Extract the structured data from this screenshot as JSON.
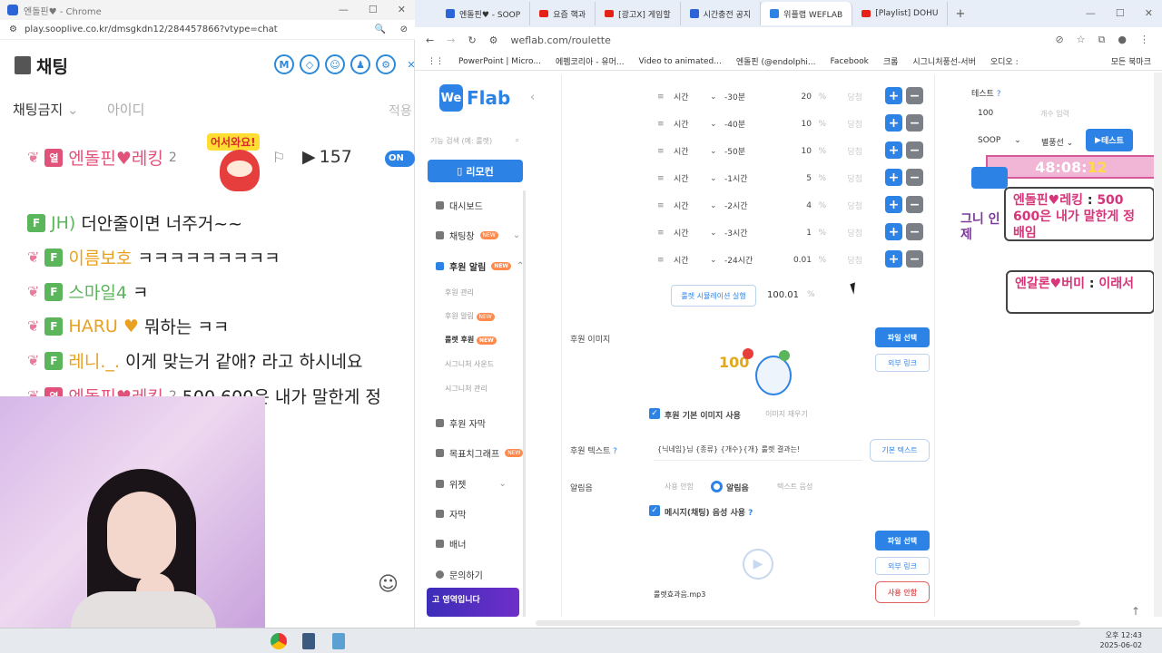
{
  "left_window": {
    "title": "엔돌핀♥ - Chrome",
    "url": "play.sooplive.co.kr/dmsgkdn12/284457866?vtype=chat",
    "chat_title": "채팅",
    "filter_label": "채팅금지",
    "filter_label2": "아이디",
    "filter_label3": "적용",
    "on_label": "ON",
    "viewer_count": "157",
    "sticker_text": "어서와요!",
    "messages": [
      {
        "badge": "열",
        "nick": "엔돌핀♥레킹",
        "level": "2",
        "text": ""
      },
      {
        "badge": "F",
        "nick": "JH)",
        "text": "더안줄이면 너주거~~"
      },
      {
        "badge": "F",
        "nick": "이름보호",
        "text": "ㅋㅋㅋㅋㅋㅋㅋㅋㅋ"
      },
      {
        "badge": "F",
        "nick": "스마일4",
        "text": "ㅋ"
      },
      {
        "badge": "F",
        "nick": "HARU",
        "text": "뭐하는 ㅋㅋ"
      },
      {
        "badge": "F",
        "nick": "레니._.",
        "text": "이게 맞는거 같애? 라고 하시네요"
      },
      {
        "badge": "열",
        "nick": "엔돌핀♥레킹",
        "level": "2",
        "text": "500 600은 내가 말한게 정"
      }
    ]
  },
  "browser": {
    "tabs": [
      {
        "label": "엔돌핀♥ - SOOP",
        "active": false
      },
      {
        "label": "요즘 핵과",
        "active": false
      },
      {
        "label": "[광고X] 게임할",
        "active": false
      },
      {
        "label": "시간충전 공지",
        "active": false
      },
      {
        "label": "위플랩 WEFLAB",
        "active": true
      },
      {
        "label": "[Playlist] DOHU",
        "active": false
      }
    ],
    "url": "weflab.com/roulette",
    "bookmarks": [
      "PowerPoint | Micro...",
      "에펨코리아 - 유머...",
      "Video to animated...",
      "엔돌핀 (@endolphi...",
      "Facebook",
      "크롬",
      "시그니처풍선-서버",
      "오디오 :",
      "모든 북마크"
    ]
  },
  "sidebar": {
    "logo_box": "We",
    "logo_text": "Flab",
    "search_placeholder": "기능 검색 (예: 룰렛)",
    "remote_button": "리모컨",
    "items": [
      {
        "label": "대시보드"
      },
      {
        "label": "채팅창",
        "new": "NEW"
      },
      {
        "label": "후원 알림",
        "new": "NEW"
      },
      {
        "label": "위젯"
      },
      {
        "label": "자막"
      },
      {
        "label": "배너"
      },
      {
        "label": "문의하기"
      }
    ],
    "subitems": [
      "후원 관리",
      "후원 알림",
      "룰렛 후원",
      "시그니처 사운드",
      "시그니처 관리"
    ],
    "extra_items": [
      "후원 자막",
      "목표치그래프"
    ],
    "new_badge": "NEW",
    "ad_text": "고 영역입니다"
  },
  "roulette": {
    "rows": [
      {
        "kind": "시간",
        "time": "-30분",
        "value": "20",
        "pct": "%",
        "pick": "당첨"
      },
      {
        "kind": "시간",
        "time": "-40분",
        "value": "10",
        "pct": "%",
        "pick": "당첨"
      },
      {
        "kind": "시간",
        "time": "-50분",
        "value": "10",
        "pct": "%",
        "pick": "당첨"
      },
      {
        "kind": "시간",
        "time": "-1시간",
        "value": "5",
        "pct": "%",
        "pick": "당첨"
      },
      {
        "kind": "시간",
        "time": "-2시간",
        "value": "4",
        "pct": "%",
        "pick": "당첨"
      },
      {
        "kind": "시간",
        "time": "-3시간",
        "value": "1",
        "pct": "%",
        "pick": "당첨"
      },
      {
        "kind": "시간",
        "time": "-24시간",
        "value": "0.01",
        "pct": "%",
        "pick": "당첨"
      }
    ],
    "simulate_button": "룰렛 시뮬레이션 실행",
    "total": "100.01",
    "total_unit": "%",
    "image_label": "후원 이미지",
    "file_select": "파일 선택",
    "external_link": "외부 링크",
    "default_image_check": "후원 기본 이미지 사용",
    "image_reset": "이미지 재우기",
    "text_label": "후원 텍스트",
    "text_value": "{닉네임}님 {종류} {개수}{개} 룰렛 결과는!",
    "default_text_btn": "기본 텍스트",
    "alert_label": "알림음",
    "alert_opt1": "사용 안함",
    "alert_opt2": "알림음",
    "alert_opt3": "텍스트 음성",
    "msg_voice_check": "메시지(채팅) 음성 사용",
    "file_select2": "파일 선택",
    "external_link2": "외부 링크",
    "no_use_btn": "사용 안함",
    "mp3_name": "룰렛효과음.mp3",
    "image_badge": "100"
  },
  "right_panel": {
    "test_label": "테스트",
    "amount": "100",
    "amount_hint": "개수 입력",
    "platform": "SOOP",
    "balloon": "별풍선",
    "test_button": "테스트",
    "timer_main": "48:08:",
    "timer_sec": "12",
    "overlay1_nick": "엔돌핀♥레킹",
    "overlay1_text": "500 600은 내가 말한게 정배임",
    "overlay2_nick": "엔갈론♥버미",
    "overlay2_text": "이래서",
    "side_text": "그니 인 제"
  },
  "taskbar": {
    "time": "오후 12:43",
    "date": "2025-06-02"
  }
}
